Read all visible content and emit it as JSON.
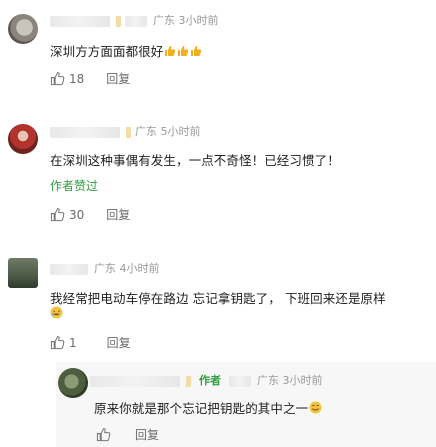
{
  "comments": [
    {
      "location_time": "广东 3小时前",
      "text": "深圳方方面面都很好",
      "likes": "18",
      "reply_label": "回复"
    },
    {
      "location_time": "广东 5小时前",
      "text": "在深圳这种事偶有发生，一点不奇怪！已经习惯了！",
      "author_liked": "作者赞过",
      "likes": "30",
      "reply_label": "回复"
    },
    {
      "location_time": "广东 4小时前",
      "text_line1": "我经常把电动车停在路边 忘记拿钥匙了， 下班回来还是原样",
      "likes": "1",
      "reply_label": "回复"
    }
  ],
  "reply": {
    "author_badge": "作者",
    "location_time": "广东 3小时前",
    "text": "原来你就是那个忘记把钥匙的其中之一",
    "reply_label": "回复"
  },
  "icons": [
    "thumbs-up-icon",
    "thumbs-up-emoji-icon",
    "laugh-emoji-icon",
    "smile-emoji-icon"
  ]
}
